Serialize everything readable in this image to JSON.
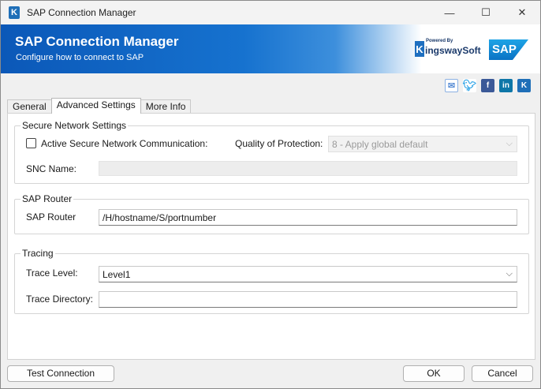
{
  "window": {
    "title": "SAP Connection Manager",
    "minimize_glyph": "—",
    "maximize_glyph": "☐",
    "close_glyph": "✕"
  },
  "banner": {
    "title": "SAP Connection Manager",
    "subtitle": "Configure how to connect to SAP",
    "kingsway_powered": "Powered By",
    "kingsway_name": "ingswaySoft",
    "kingsway_k": "K",
    "sap_logo_text": "SAP"
  },
  "social": [
    "email-icon",
    "twitter-icon",
    "facebook-icon",
    "linkedin-icon",
    "kingsway-icon"
  ],
  "tabs": [
    {
      "label": "General",
      "active": false
    },
    {
      "label": "Advanced Settings",
      "active": true
    },
    {
      "label": "More Info",
      "active": false
    }
  ],
  "secure_network": {
    "legend": "Secure Network Settings",
    "active_snc_label": "Active Secure Network Communication:",
    "active_snc_checked": false,
    "qop_label": "Quality of Protection:",
    "qop_value": "8 - Apply global default",
    "snc_name_label": "SNC Name:",
    "snc_name_value": ""
  },
  "sap_router": {
    "legend": "SAP Router",
    "label": "SAP Router",
    "value": "/H/hostname/S/portnumber"
  },
  "tracing": {
    "legend": "Tracing",
    "trace_level_label": "Trace Level:",
    "trace_level_value": "Level1",
    "trace_dir_label": "Trace Directory:",
    "trace_dir_value": ""
  },
  "buttons": {
    "test_connection": "Test Connection",
    "ok": "OK",
    "cancel": "Cancel"
  },
  "dropdown_glyph": "⌵",
  "colors": {
    "banner_blue": "#0b58b8",
    "accent": "#1f6fb8"
  }
}
